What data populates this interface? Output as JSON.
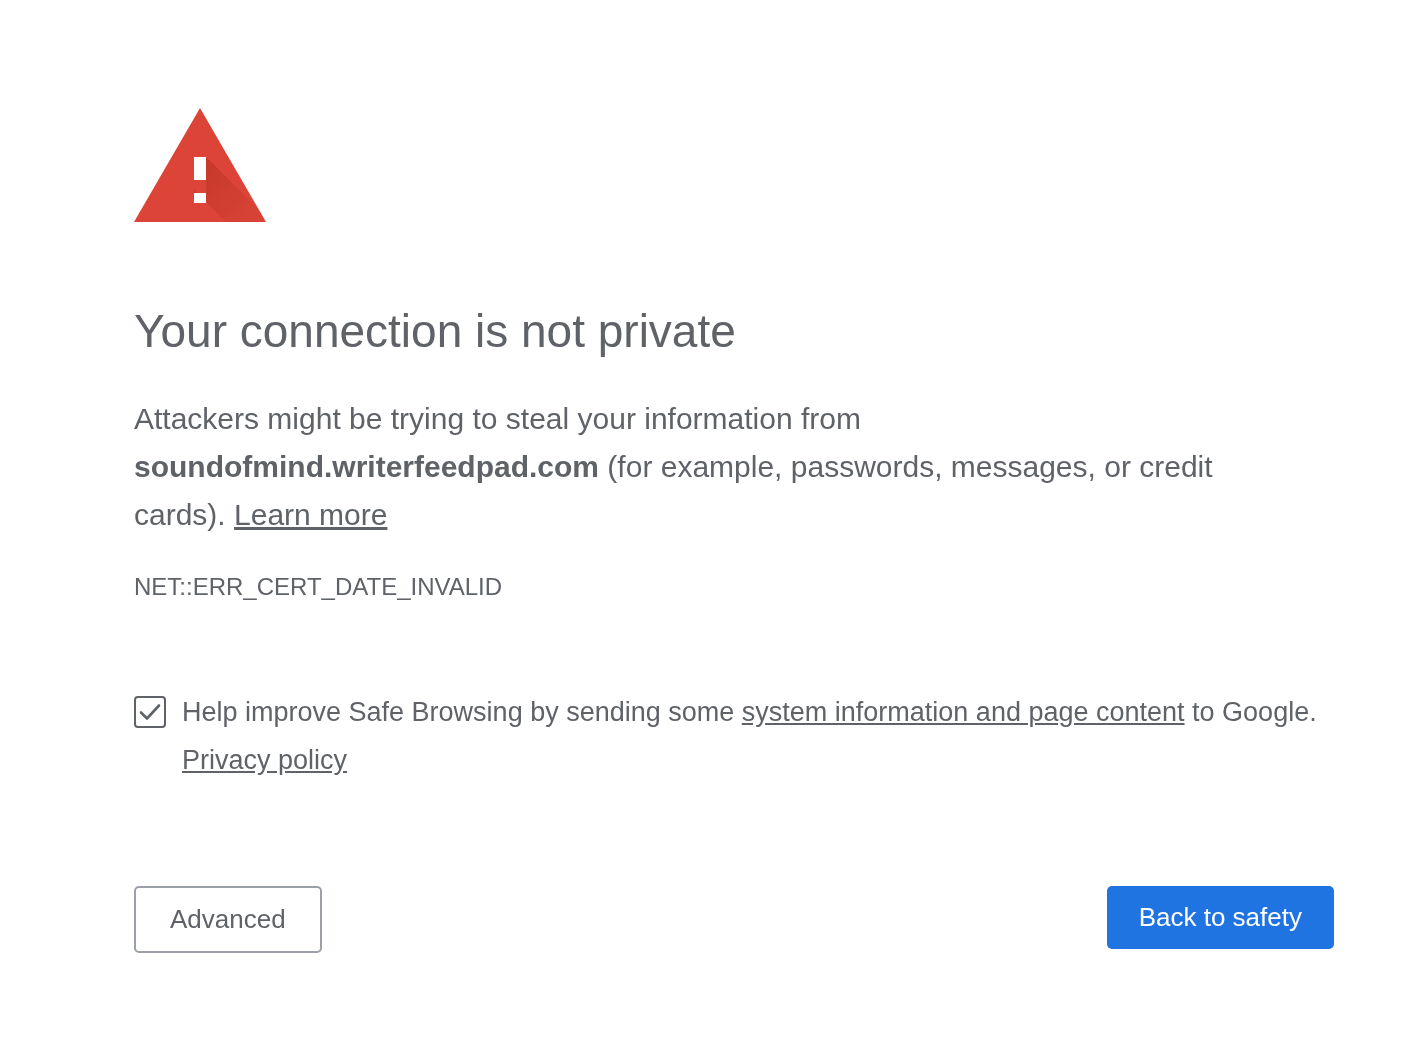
{
  "title": "Your connection is not private",
  "message": {
    "text": "Attackers might be trying to steal your information from **soundofmind.writerfeedpad.com** (for example, passwords, messages, or credit cards).",
    "link": "Learn more"
  },
  "error_code": "NET::ERR_CERT_DATE_INVALID",
  "safe_browsing": {
    "checked": true,
    "text_before": "Help improve Safe Browsing by sending some",
    "link": "system information and page content",
    "text_after": "to Google.",
    "privacy_link": "Privacy policy"
  },
  "buttons": [
    {
      "kind": "secondary",
      "label": "Advanced"
    },
    {
      "kind": "primary",
      "label": "Back to safety"
    }
  ]
}
